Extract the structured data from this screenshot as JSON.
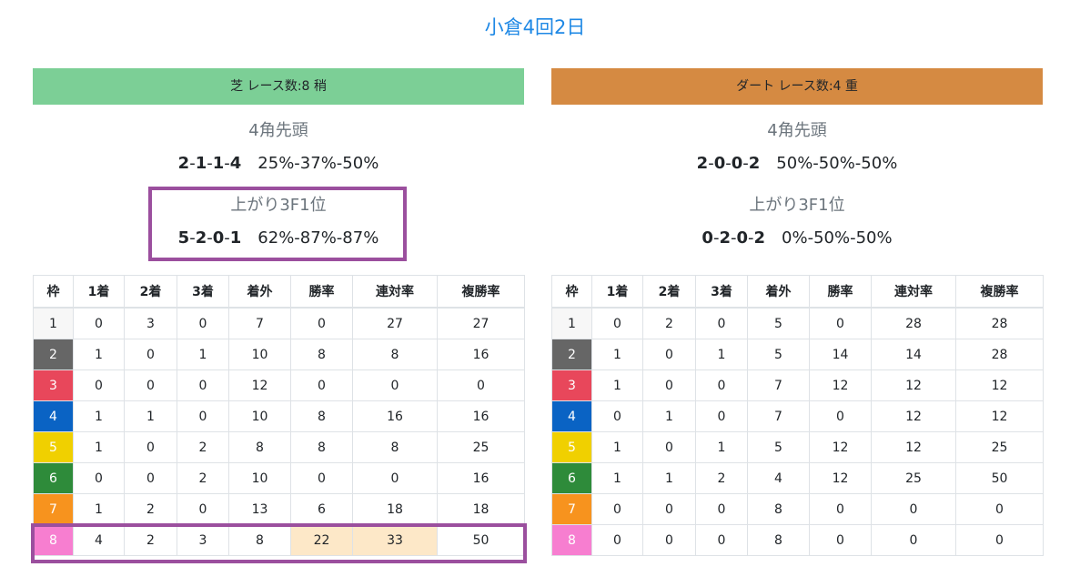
{
  "page": {
    "title": "小倉4回2日"
  },
  "turf": {
    "header": "芝 レース数:8 稍",
    "corner4": {
      "label": "4角先頭",
      "record": [
        "2",
        "1",
        "1",
        "4"
      ],
      "rates": "25%-37%-50%"
    },
    "last3f": {
      "label": "上がり3F1位",
      "record": [
        "5",
        "2",
        "0",
        "1"
      ],
      "rates": "62%-87%-87%"
    },
    "columns": [
      "枠",
      "1着",
      "2着",
      "3着",
      "着外",
      "勝率",
      "連対率",
      "複勝率"
    ],
    "rows": [
      [
        "1",
        "0",
        "3",
        "0",
        "7",
        "0",
        "27",
        "27"
      ],
      [
        "2",
        "1",
        "0",
        "1",
        "10",
        "8",
        "8",
        "16"
      ],
      [
        "3",
        "0",
        "0",
        "0",
        "12",
        "0",
        "0",
        "0"
      ],
      [
        "4",
        "1",
        "1",
        "0",
        "10",
        "8",
        "16",
        "16"
      ],
      [
        "5",
        "1",
        "0",
        "2",
        "8",
        "8",
        "8",
        "25"
      ],
      [
        "6",
        "0",
        "0",
        "2",
        "10",
        "0",
        "0",
        "16"
      ],
      [
        "7",
        "1",
        "2",
        "0",
        "13",
        "6",
        "18",
        "18"
      ],
      [
        "8",
        "4",
        "2",
        "3",
        "8",
        "22",
        "33",
        "50"
      ]
    ]
  },
  "dirt": {
    "header": "ダート レース数:4 重",
    "corner4": {
      "label": "4角先頭",
      "record": [
        "2",
        "0",
        "0",
        "2"
      ],
      "rates": "50%-50%-50%"
    },
    "last3f": {
      "label": "上がり3F1位",
      "record": [
        "0",
        "2",
        "0",
        "2"
      ],
      "rates": "0%-50%-50%"
    },
    "columns": [
      "枠",
      "1着",
      "2着",
      "3着",
      "着外",
      "勝率",
      "連対率",
      "複勝率"
    ],
    "rows": [
      [
        "1",
        "0",
        "2",
        "0",
        "5",
        "0",
        "28",
        "28"
      ],
      [
        "2",
        "1",
        "0",
        "1",
        "5",
        "14",
        "14",
        "28"
      ],
      [
        "3",
        "1",
        "0",
        "0",
        "7",
        "12",
        "12",
        "12"
      ],
      [
        "4",
        "0",
        "1",
        "0",
        "7",
        "0",
        "12",
        "12"
      ],
      [
        "5",
        "1",
        "0",
        "1",
        "5",
        "12",
        "12",
        "25"
      ],
      [
        "6",
        "1",
        "1",
        "2",
        "4",
        "12",
        "25",
        "50"
      ],
      [
        "7",
        "0",
        "0",
        "0",
        "8",
        "0",
        "0",
        "0"
      ],
      [
        "8",
        "0",
        "0",
        "0",
        "8",
        "0",
        "0",
        "0"
      ]
    ]
  },
  "colors": {
    "title": "#1e88e5",
    "turf_header": "#7ccf96",
    "dirt_header": "#d58a42",
    "highlight_border": "#9b4f9e",
    "highlight_cell": "#fde8c8",
    "waku": [
      "#f7f7f7",
      "#666666",
      "#e8475b",
      "#0a63c4",
      "#f0d000",
      "#2e8b3a",
      "#f7931e",
      "#f77ed0"
    ]
  }
}
